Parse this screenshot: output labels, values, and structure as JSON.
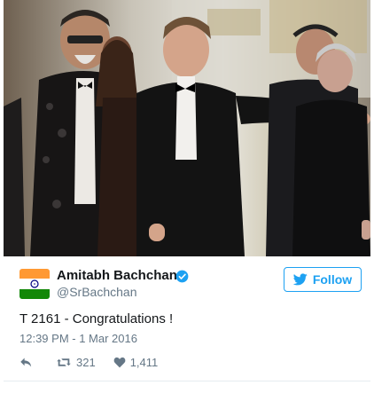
{
  "tweet": {
    "author_name": "Amitabh Bachchan",
    "handle": "@SrBachchan",
    "verified": true,
    "follow_label": "Follow",
    "text": "T 2161 - Congratulations !",
    "timestamp": "12:39 PM - 1 Mar 2016",
    "retweet_count": "321",
    "like_count": "1,411"
  },
  "icons": {
    "verified": "verified-badge-icon",
    "follow": "twitter-bird-icon",
    "reply": "reply-icon",
    "retweet": "retweet-icon",
    "like": "heart-icon"
  },
  "colors": {
    "accent": "#1da1f2",
    "text": "#14171a",
    "secondary": "#657786"
  }
}
